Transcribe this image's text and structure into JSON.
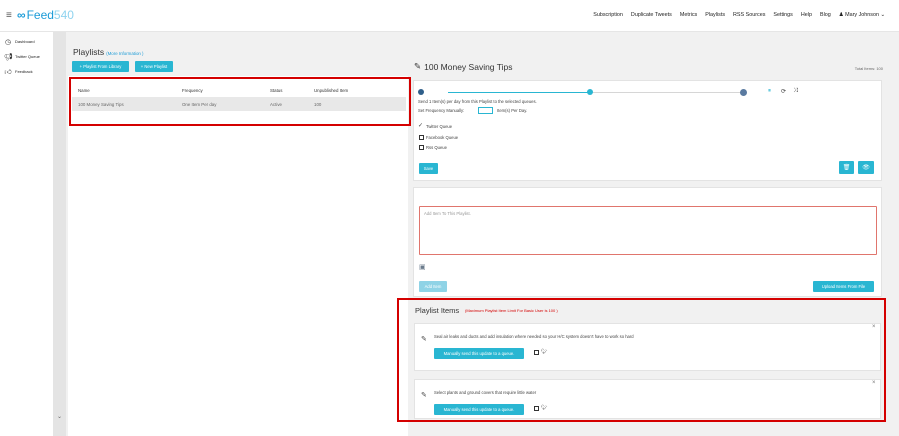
{
  "header": {
    "logo_mark": "∞",
    "logo_text": "Feed",
    "logo_num": "540",
    "nav": [
      "Subscription",
      "Duplicate Tweets",
      "Metrics",
      "Playlists",
      "RSS Sources",
      "Settings",
      "Help",
      "Blog",
      "Mary Johnson"
    ]
  },
  "sidebar": {
    "items": [
      {
        "label": "Dashboard",
        "icon": "clock-icon"
      },
      {
        "label": "Twitter Queue",
        "icon": "megaphone-icon"
      },
      {
        "label": "Feedback",
        "icon": "thumbs-up-icon"
      }
    ]
  },
  "playlists": {
    "title": "Playlists",
    "more_info": "(More Information )",
    "btn_library": "+ Playlist From Library",
    "btn_new": "+ New Playlist",
    "columns": [
      "Name",
      "Frequency",
      "Status",
      "Unpublished Item"
    ],
    "rows": [
      [
        "100 Money Saving Tips",
        "One Item Per day",
        "Active",
        "100"
      ]
    ]
  },
  "detail": {
    "title": "100 Money Saving Tips",
    "total": "Total Items: 100",
    "send_text": "Send 1 Item(s) per day from this Playlist to the selected queues.",
    "freq_label": "Set Frequency Manually:",
    "freq_suffix": "Item(s) Per Day.",
    "queues": [
      "Twitter Queue",
      "Facebook Queue",
      "Rss Queue"
    ],
    "save": "Save",
    "add_placeholder": "Add Item To This Playlist.",
    "add_item": "Add Item",
    "upload": "Upload Items From File"
  },
  "items_section": {
    "title": "Playlist Items",
    "limit": "(Maximum Playlist Item Limit For Basic User is 100 )",
    "send_btn": "Manually send this update to a queue.",
    "items": [
      "Seal air leaks and ducts and add insulation where needed so your H/C system doesn't have to work so hard",
      "Select plants and ground covers that require little water"
    ]
  },
  "colors": {
    "accent": "#29b6d2",
    "logo": "#1b9bd7",
    "highlight": "#d40000"
  }
}
